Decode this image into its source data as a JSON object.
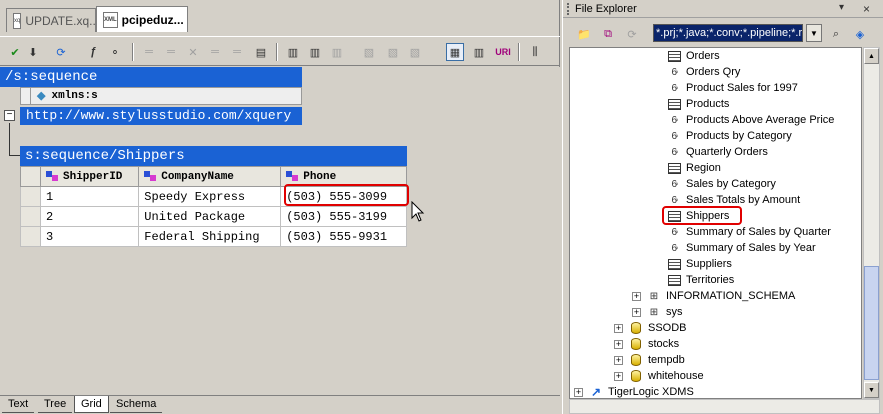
{
  "editor": {
    "tabs": [
      {
        "label": "UPDATE.xq...",
        "icon": "xquery-file-icon"
      },
      {
        "label": "pcipeduz...",
        "icon": "xml-file-icon",
        "icon_text": "XML"
      }
    ],
    "root_node": "/s:sequence",
    "namespace_attr": "xmlns:s",
    "namespace_value": "http://www.stylusstudio.com/xquery",
    "table_title": "s:sequence/Shippers",
    "columns": [
      "ShipperID",
      "CompanyName",
      "Phone"
    ],
    "rows": [
      [
        "1",
        "Speedy Express",
        "(503) 555-3099"
      ],
      [
        "2",
        "United Package",
        "(503) 555-3199"
      ],
      [
        "3",
        "Federal Shipping",
        "(503) 555-9931"
      ]
    ],
    "view_tabs": [
      "Text",
      "Tree",
      "Grid",
      "Schema"
    ],
    "active_view_tab": "Grid",
    "expander_symbol": "−"
  },
  "explorer": {
    "title": "File Explorer",
    "title_buttons": [
      "▾",
      "×"
    ],
    "filter": "*.prj;*.java;*.conv;*.pipeline;*.re",
    "tree": [
      {
        "label": "Orders",
        "icon": "table",
        "indent": 3
      },
      {
        "label": "Orders Qry",
        "icon": "view",
        "indent": 3
      },
      {
        "label": "Product Sales for 1997",
        "icon": "view",
        "indent": 3
      },
      {
        "label": "Products",
        "icon": "table",
        "indent": 3
      },
      {
        "label": "Products Above Average Price",
        "icon": "view",
        "indent": 3
      },
      {
        "label": "Products by Category",
        "icon": "view",
        "indent": 3
      },
      {
        "label": "Quarterly Orders",
        "icon": "view",
        "indent": 3
      },
      {
        "label": "Region",
        "icon": "table",
        "indent": 3
      },
      {
        "label": "Sales by Category",
        "icon": "view",
        "indent": 3
      },
      {
        "label": "Sales Totals by Amount",
        "icon": "view",
        "indent": 3
      },
      {
        "label": "Shippers",
        "icon": "table",
        "indent": 3,
        "selected": true
      },
      {
        "label": "Summary of Sales by Quarter",
        "icon": "view",
        "indent": 3
      },
      {
        "label": "Summary of Sales by Year",
        "icon": "view",
        "indent": 3
      },
      {
        "label": "Suppliers",
        "icon": "table",
        "indent": 3
      },
      {
        "label": "Territories",
        "icon": "table",
        "indent": 3
      },
      {
        "label": "INFORMATION_SCHEMA",
        "icon": "schema",
        "indent": 2,
        "expander": "+"
      },
      {
        "label": "sys",
        "icon": "schema",
        "indent": 2,
        "expander": "+"
      },
      {
        "label": "SSODB",
        "icon": "db",
        "indent": 1,
        "expander": "+"
      },
      {
        "label": "stocks",
        "icon": "db",
        "indent": 1,
        "expander": "+"
      },
      {
        "label": "tempdb",
        "icon": "db",
        "indent": 1,
        "expander": "+"
      },
      {
        "label": "whitehouse",
        "icon": "db",
        "indent": 1,
        "expander": "+"
      },
      {
        "label": "TigerLogic XDMS",
        "icon": "tigerlogic",
        "indent": 0,
        "expander": "+"
      }
    ]
  },
  "colors": {
    "header_blue": "#1a62d4",
    "highlight_red": "#e00000",
    "panel_gray": "#d4d0c8"
  }
}
